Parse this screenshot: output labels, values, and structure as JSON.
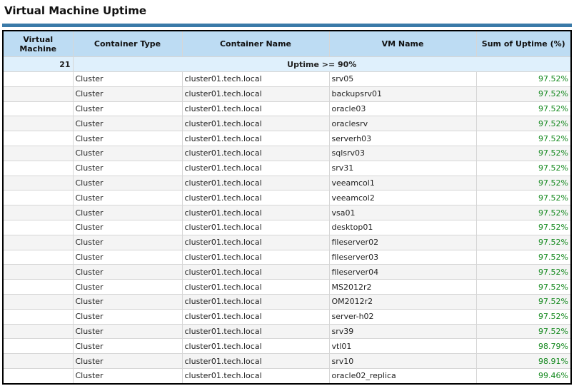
{
  "title": "Virtual Machine Uptime",
  "colors": {
    "accent_bar": "#3a7aa8",
    "header_bg": "#bddcf3",
    "group_bg": "#dff0fc",
    "percent_text": "#12881c"
  },
  "table": {
    "headers": [
      "Virtual Machine",
      "Container Type",
      "Container Name",
      "VM Name",
      "Sum of Uptime (%)"
    ],
    "group": {
      "count": "21",
      "label": "Uptime >= 90%"
    },
    "rows": [
      {
        "type": "Cluster",
        "container": "cluster01.tech.local",
        "vm": "srv05",
        "uptime": "97.52%"
      },
      {
        "type": "Cluster",
        "container": "cluster01.tech.local",
        "vm": "backupsrv01",
        "uptime": "97.52%"
      },
      {
        "type": "Cluster",
        "container": "cluster01.tech.local",
        "vm": "oracle03",
        "uptime": "97.52%"
      },
      {
        "type": "Cluster",
        "container": "cluster01.tech.local",
        "vm": "oraclesrv",
        "uptime": "97.52%"
      },
      {
        "type": "Cluster",
        "container": "cluster01.tech.local",
        "vm": "serverh03",
        "uptime": "97.52%"
      },
      {
        "type": "Cluster",
        "container": "cluster01.tech.local",
        "vm": "sqlsrv03",
        "uptime": "97.52%"
      },
      {
        "type": "Cluster",
        "container": "cluster01.tech.local",
        "vm": "srv31",
        "uptime": "97.52%"
      },
      {
        "type": "Cluster",
        "container": "cluster01.tech.local",
        "vm": "veeamcol1",
        "uptime": "97.52%"
      },
      {
        "type": "Cluster",
        "container": "cluster01.tech.local",
        "vm": "veeamcol2",
        "uptime": "97.52%"
      },
      {
        "type": "Cluster",
        "container": "cluster01.tech.local",
        "vm": "vsa01",
        "uptime": "97.52%"
      },
      {
        "type": "Cluster",
        "container": "cluster01.tech.local",
        "vm": "desktop01",
        "uptime": "97.52%"
      },
      {
        "type": "Cluster",
        "container": "cluster01.tech.local",
        "vm": "fileserver02",
        "uptime": "97.52%"
      },
      {
        "type": "Cluster",
        "container": "cluster01.tech.local",
        "vm": "fileserver03",
        "uptime": "97.52%"
      },
      {
        "type": "Cluster",
        "container": "cluster01.tech.local",
        "vm": "fileserver04",
        "uptime": "97.52%"
      },
      {
        "type": "Cluster",
        "container": "cluster01.tech.local",
        "vm": "MS2012r2",
        "uptime": "97.52%"
      },
      {
        "type": "Cluster",
        "container": "cluster01.tech.local",
        "vm": "OM2012r2",
        "uptime": "97.52%"
      },
      {
        "type": "Cluster",
        "container": "cluster01.tech.local",
        "vm": "server-h02",
        "uptime": "97.52%"
      },
      {
        "type": "Cluster",
        "container": "cluster01.tech.local",
        "vm": "srv39",
        "uptime": "97.52%"
      },
      {
        "type": "Cluster",
        "container": "cluster01.tech.local",
        "vm": "vtl01",
        "uptime": "98.79%"
      },
      {
        "type": "Cluster",
        "container": "cluster01.tech.local",
        "vm": "srv10",
        "uptime": "98.91%"
      },
      {
        "type": "Cluster",
        "container": "cluster01.tech.local",
        "vm": "oracle02_replica",
        "uptime": "99.46%"
      }
    ]
  }
}
